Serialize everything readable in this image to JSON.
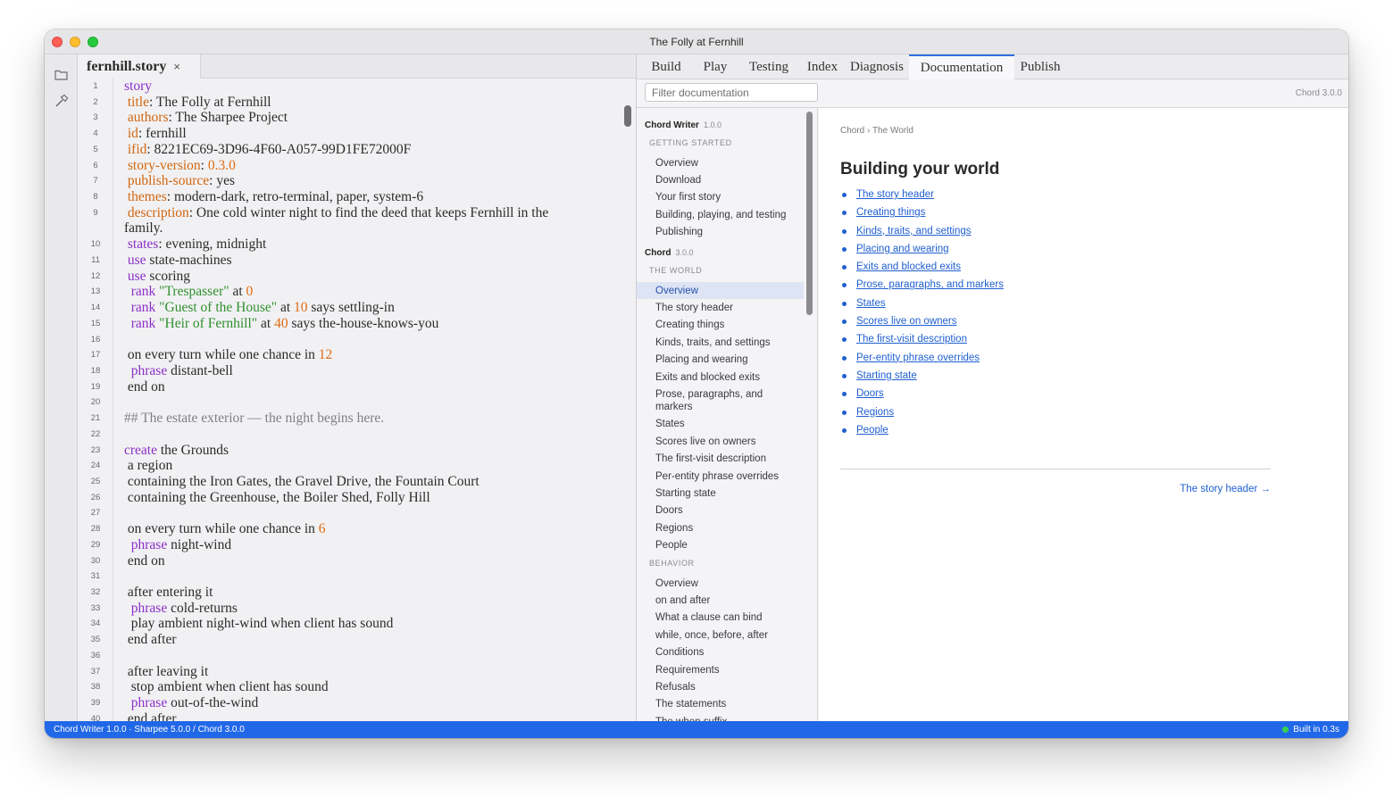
{
  "window": {
    "title": "The Folly at Fernhill"
  },
  "editor": {
    "file_tab": {
      "name": "fernhill.story",
      "close": "×"
    },
    "lines": [
      {
        "n": 1,
        "segs": [
          {
            "t": "story",
            "c": "kw"
          }
        ]
      },
      {
        "n": 2,
        "segs": [
          {
            "t": " "
          },
          {
            "t": "title",
            "c": "prop"
          },
          {
            "t": ": The Folly at Fernhill"
          }
        ]
      },
      {
        "n": 3,
        "segs": [
          {
            "t": " "
          },
          {
            "t": "authors",
            "c": "prop"
          },
          {
            "t": ": The Sharpee Project"
          }
        ]
      },
      {
        "n": 4,
        "segs": [
          {
            "t": " "
          },
          {
            "t": "id",
            "c": "prop"
          },
          {
            "t": ": fernhill"
          }
        ]
      },
      {
        "n": 5,
        "segs": [
          {
            "t": " "
          },
          {
            "t": "ifid",
            "c": "prop"
          },
          {
            "t": ": 8221EC69-3D96-4F60-A057-99D1FE72000F"
          }
        ]
      },
      {
        "n": 6,
        "segs": [
          {
            "t": " "
          },
          {
            "t": "story-version",
            "c": "prop"
          },
          {
            "t": ": "
          },
          {
            "t": "0.3.0",
            "c": "num"
          }
        ]
      },
      {
        "n": 7,
        "segs": [
          {
            "t": " "
          },
          {
            "t": "publish-source",
            "c": "prop"
          },
          {
            "t": ": yes"
          }
        ]
      },
      {
        "n": 8,
        "segs": [
          {
            "t": " "
          },
          {
            "t": "themes",
            "c": "prop"
          },
          {
            "t": ": modern-dark, retro-terminal, paper, system-6"
          }
        ]
      },
      {
        "n": 9,
        "segs": [
          {
            "t": " "
          },
          {
            "t": "description",
            "c": "prop"
          },
          {
            "t": ": One cold winter night to find the deed that keeps Fernhill in the"
          }
        ]
      },
      {
        "n": "",
        "segs": [
          {
            "t": "family."
          }
        ]
      },
      {
        "n": 10,
        "segs": [
          {
            "t": " "
          },
          {
            "t": "states",
            "c": "kw"
          },
          {
            "t": ": evening, midnight"
          }
        ]
      },
      {
        "n": 11,
        "segs": [
          {
            "t": " "
          },
          {
            "t": "use",
            "c": "kw"
          },
          {
            "t": " state-machines"
          }
        ]
      },
      {
        "n": 12,
        "segs": [
          {
            "t": " "
          },
          {
            "t": "use",
            "c": "kw"
          },
          {
            "t": " scoring"
          }
        ]
      },
      {
        "n": 13,
        "segs": [
          {
            "t": "  "
          },
          {
            "t": "rank",
            "c": "kw"
          },
          {
            "t": " "
          },
          {
            "t": "\"Trespasser\"",
            "c": "str"
          },
          {
            "t": " at "
          },
          {
            "t": "0",
            "c": "num"
          }
        ]
      },
      {
        "n": 14,
        "segs": [
          {
            "t": "  "
          },
          {
            "t": "rank",
            "c": "kw"
          },
          {
            "t": " "
          },
          {
            "t": "\"Guest of the House\"",
            "c": "str"
          },
          {
            "t": " at "
          },
          {
            "t": "10",
            "c": "num"
          },
          {
            "t": " says settling-in"
          }
        ]
      },
      {
        "n": 15,
        "segs": [
          {
            "t": "  "
          },
          {
            "t": "rank",
            "c": "kw"
          },
          {
            "t": " "
          },
          {
            "t": "\"Heir of Fernhill\"",
            "c": "str"
          },
          {
            "t": " at "
          },
          {
            "t": "40",
            "c": "num"
          },
          {
            "t": " says the-house-knows-you"
          }
        ]
      },
      {
        "n": 16,
        "segs": []
      },
      {
        "n": 17,
        "segs": [
          {
            "t": " on every turn while one chance in "
          },
          {
            "t": "12",
            "c": "num"
          }
        ]
      },
      {
        "n": 18,
        "segs": [
          {
            "t": "  "
          },
          {
            "t": "phrase",
            "c": "kw"
          },
          {
            "t": " distant-bell"
          }
        ]
      },
      {
        "n": 19,
        "segs": [
          {
            "t": " end on"
          }
        ]
      },
      {
        "n": 20,
        "segs": []
      },
      {
        "n": 21,
        "segs": [
          {
            "t": "## The estate exterior — the night begins here.",
            "c": "cmt"
          }
        ]
      },
      {
        "n": 22,
        "segs": []
      },
      {
        "n": 23,
        "segs": [
          {
            "t": "create",
            "c": "kw"
          },
          {
            "t": " the Grounds"
          }
        ]
      },
      {
        "n": 24,
        "segs": [
          {
            "t": " a region"
          }
        ]
      },
      {
        "n": 25,
        "segs": [
          {
            "t": " containing the Iron Gates, the Gravel Drive, the Fountain Court"
          }
        ]
      },
      {
        "n": 26,
        "segs": [
          {
            "t": " containing the Greenhouse, the Boiler Shed, Folly Hill"
          }
        ]
      },
      {
        "n": 27,
        "segs": []
      },
      {
        "n": 28,
        "segs": [
          {
            "t": " on every turn while one chance in "
          },
          {
            "t": "6",
            "c": "num"
          }
        ]
      },
      {
        "n": 29,
        "segs": [
          {
            "t": "  "
          },
          {
            "t": "phrase",
            "c": "kw"
          },
          {
            "t": " night-wind"
          }
        ]
      },
      {
        "n": 30,
        "segs": [
          {
            "t": " end on"
          }
        ]
      },
      {
        "n": 31,
        "segs": []
      },
      {
        "n": 32,
        "segs": [
          {
            "t": " after entering it"
          }
        ]
      },
      {
        "n": 33,
        "segs": [
          {
            "t": "  "
          },
          {
            "t": "phrase",
            "c": "kw"
          },
          {
            "t": " cold-returns"
          }
        ]
      },
      {
        "n": 34,
        "segs": [
          {
            "t": "  play ambient night-wind when client has sound"
          }
        ]
      },
      {
        "n": 35,
        "segs": [
          {
            "t": " end after"
          }
        ]
      },
      {
        "n": 36,
        "segs": []
      },
      {
        "n": 37,
        "segs": [
          {
            "t": " after leaving it"
          }
        ]
      },
      {
        "n": 38,
        "segs": [
          {
            "t": "  stop ambient when client has sound"
          }
        ]
      },
      {
        "n": 39,
        "segs": [
          {
            "t": "  "
          },
          {
            "t": "phrase",
            "c": "kw"
          },
          {
            "t": " out-of-the-wind"
          }
        ]
      },
      {
        "n": 40,
        "segs": [
          {
            "t": " end after"
          }
        ]
      }
    ]
  },
  "top_tabs": [
    {
      "label": "Build",
      "active": false
    },
    {
      "label": "Play",
      "active": false
    },
    {
      "label": "Testing",
      "active": false
    },
    {
      "label": "Index",
      "active": false
    },
    {
      "label": "Diagnosis",
      "active": false
    },
    {
      "label": "Documentation",
      "active": true
    },
    {
      "label": "Publish",
      "active": false
    }
  ],
  "docs": {
    "filter_placeholder": "Filter documentation",
    "version": "Chord 3.0.0",
    "nav": [
      {
        "type": "header",
        "label": "Chord Writer",
        "version": "1.0.0"
      },
      {
        "type": "section",
        "label": "GETTING STARTED"
      },
      {
        "type": "item",
        "label": "Overview"
      },
      {
        "type": "item",
        "label": "Download"
      },
      {
        "type": "item",
        "label": "Your first story"
      },
      {
        "type": "item",
        "label": "Building, playing, and testing"
      },
      {
        "type": "item",
        "label": "Publishing"
      },
      {
        "type": "header",
        "label": "Chord",
        "version": "3.0.0"
      },
      {
        "type": "section",
        "label": "THE WORLD"
      },
      {
        "type": "item",
        "label": "Overview",
        "active": true
      },
      {
        "type": "item",
        "label": "The story header"
      },
      {
        "type": "item",
        "label": "Creating things"
      },
      {
        "type": "item",
        "label": "Kinds, traits, and settings"
      },
      {
        "type": "item",
        "label": "Placing and wearing"
      },
      {
        "type": "item",
        "label": "Exits and blocked exits"
      },
      {
        "type": "item",
        "label": "Prose, paragraphs, and markers",
        "wrap": true
      },
      {
        "type": "item",
        "label": "States"
      },
      {
        "type": "item",
        "label": "Scores live on owners"
      },
      {
        "type": "item",
        "label": "The first-visit description"
      },
      {
        "type": "item",
        "label": "Per-entity phrase overrides"
      },
      {
        "type": "item",
        "label": "Starting state"
      },
      {
        "type": "item",
        "label": "Doors"
      },
      {
        "type": "item",
        "label": "Regions"
      },
      {
        "type": "item",
        "label": "People"
      },
      {
        "type": "section",
        "label": "BEHAVIOR"
      },
      {
        "type": "item",
        "label": "Overview"
      },
      {
        "type": "item",
        "label": "on and after"
      },
      {
        "type": "item",
        "label": "What a clause can bind"
      },
      {
        "type": "item",
        "label": "while, once, before, after"
      },
      {
        "type": "item",
        "label": "Conditions"
      },
      {
        "type": "item",
        "label": "Requirements"
      },
      {
        "type": "item",
        "label": "Refusals"
      },
      {
        "type": "item",
        "label": "The statements"
      },
      {
        "type": "item",
        "label": "The when suffix"
      }
    ],
    "breadcrumb": "Chord › The World",
    "title": "Building your world",
    "links": [
      "The story header",
      "Creating things",
      "Kinds, traits, and settings",
      "Placing and wearing",
      "Exits and blocked exits",
      "Prose, paragraphs, and markers",
      "States",
      "Scores live on owners",
      "The first-visit description",
      "Per-entity phrase overrides",
      "Starting state",
      "Doors",
      "Regions",
      "People"
    ],
    "next_link": "The story header →"
  },
  "status": {
    "left": "Chord Writer 1.0.0 · Sharpee 5.0.0 / Chord 3.0.0",
    "right": "Built in 0.3s",
    "ok_color": "#37d04e"
  },
  "icons": {
    "activity": [
      "folder-icon",
      "hammer-icon"
    ]
  }
}
